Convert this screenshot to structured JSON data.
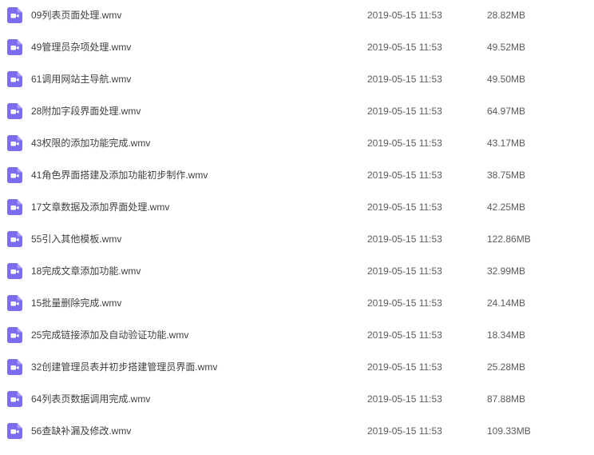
{
  "accent_color": "#7b6cf0",
  "files": [
    {
      "icon": "video-file-icon",
      "name": "09列表页面处理.wmv",
      "modified": "2019-05-15 11:53",
      "size": "28.82MB"
    },
    {
      "icon": "video-file-icon",
      "name": "49管理员杂项处理.wmv",
      "modified": "2019-05-15 11:53",
      "size": "49.52MB"
    },
    {
      "icon": "video-file-icon",
      "name": "61调用网站主导航.wmv",
      "modified": "2019-05-15 11:53",
      "size": "49.50MB"
    },
    {
      "icon": "video-file-icon",
      "name": "28附加字段界面处理.wmv",
      "modified": "2019-05-15 11:53",
      "size": "64.97MB"
    },
    {
      "icon": "video-file-icon",
      "name": "43权限的添加功能完成.wmv",
      "modified": "2019-05-15 11:53",
      "size": "43.17MB"
    },
    {
      "icon": "video-file-icon",
      "name": "41角色界面搭建及添加功能初步制作.wmv",
      "modified": "2019-05-15 11:53",
      "size": "38.75MB"
    },
    {
      "icon": "video-file-icon",
      "name": "17文章数据及添加界面处理.wmv",
      "modified": "2019-05-15 11:53",
      "size": "42.25MB"
    },
    {
      "icon": "video-file-icon",
      "name": "55引入其他模板.wmv",
      "modified": "2019-05-15 11:53",
      "size": "122.86MB"
    },
    {
      "icon": "video-file-icon",
      "name": "18完成文章添加功能.wmv",
      "modified": "2019-05-15 11:53",
      "size": "32.99MB"
    },
    {
      "icon": "video-file-icon",
      "name": "15批量删除完成.wmv",
      "modified": "2019-05-15 11:53",
      "size": "24.14MB"
    },
    {
      "icon": "video-file-icon",
      "name": "25完成链接添加及自动验证功能.wmv",
      "modified": "2019-05-15 11:53",
      "size": "18.34MB"
    },
    {
      "icon": "video-file-icon",
      "name": "32创建管理员表并初步搭建管理员界面.wmv",
      "modified": "2019-05-15 11:53",
      "size": "25.28MB"
    },
    {
      "icon": "video-file-icon",
      "name": "64列表页数据调用完成.wmv",
      "modified": "2019-05-15 11:53",
      "size": "87.88MB"
    },
    {
      "icon": "video-file-icon",
      "name": "56查缺补漏及修改.wmv",
      "modified": "2019-05-15 11:53",
      "size": "109.33MB"
    }
  ]
}
